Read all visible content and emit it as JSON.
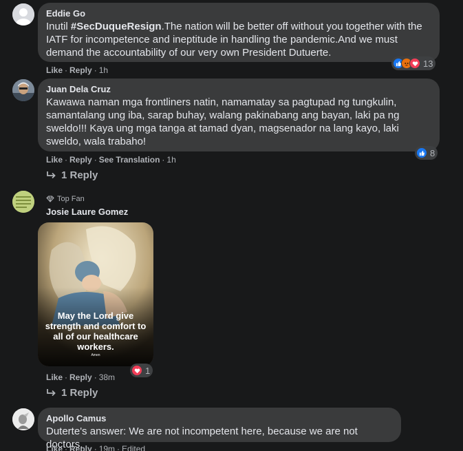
{
  "comments": [
    {
      "name": "Eddie Go",
      "text_before": "Inutil ",
      "hashtag": "#SecDuqueResign",
      "text_after": ".The nation will be better off without you together with the IATF for incompetence and ineptitude in handling the pandemic.And we must demand the accountability of our very own President Dutuerte.",
      "like": "Like",
      "reply": "Reply",
      "time": "1h",
      "reaction_count": "13",
      "reaction_icons": [
        "like-icon",
        "angry-icon",
        "love-icon"
      ]
    },
    {
      "name": "Juan Dela Cruz",
      "text": "Kawawa naman mga frontliners natin, namamatay sa pagtupad ng tungkulin, samantalang ung iba, sarap buhay, walang pakinabang ang bayan, laki pa ng sweldo!!! Kaya ung mga tanga at tamad dyan, magsenador na lang kayo, laki sweldo, wala trabaho!",
      "like": "Like",
      "reply": "Reply",
      "see_translation": "See Translation",
      "time": "1h",
      "reaction_count": "8",
      "reaction_icons": [
        "like-icon"
      ],
      "replies_label": "1 Reply"
    },
    {
      "badge": "Top Fan",
      "name": "Josie Laure Gomez",
      "image_caption": "May the Lord give strength and comfort to all of our healthcare workers.",
      "image_amen": "Amen",
      "like": "Like",
      "reply": "Reply",
      "time": "38m",
      "reaction_count": "1",
      "reaction_icons": [
        "love-icon"
      ],
      "replies_label": "1 Reply"
    },
    {
      "name": "Apollo Camus",
      "text": "Duterte's answer: We are not incompetent here, because we are not doctors.",
      "like": "Like",
      "reply": "Reply",
      "time": "19m",
      "edited": "Edited"
    }
  ],
  "colors": {
    "background": "#18191a",
    "bubble": "#3a3b3c",
    "like_blue": "#1877f2",
    "love_red": "#f33e58",
    "angry_orange": "#e9710f"
  }
}
